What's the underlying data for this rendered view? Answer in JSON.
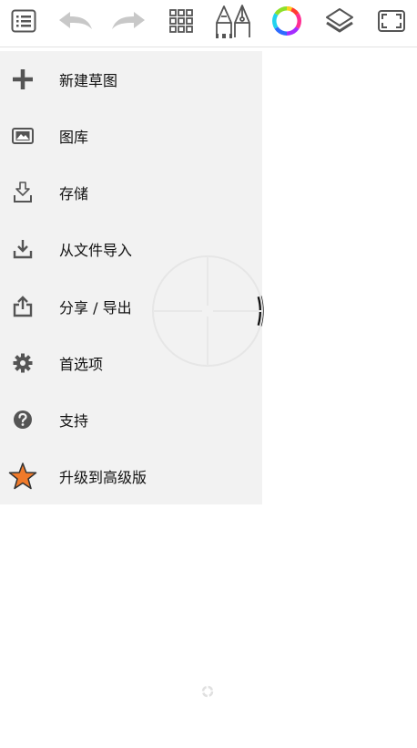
{
  "toolbar": {
    "buttons": [
      {
        "icon": "menu-list-icon",
        "enabled": true
      },
      {
        "icon": "undo-icon",
        "enabled": false
      },
      {
        "icon": "redo-icon",
        "enabled": false
      },
      {
        "icon": "grid-icon",
        "enabled": true
      },
      {
        "icon": "brush-library-icon",
        "enabled": true
      },
      {
        "icon": "color-wheel-icon",
        "enabled": true
      },
      {
        "icon": "layers-icon",
        "enabled": true
      },
      {
        "icon": "fullscreen-icon",
        "enabled": true
      }
    ]
  },
  "menu": {
    "items": [
      {
        "label": "新建草图",
        "icon": "plus-icon"
      },
      {
        "label": "图库",
        "icon": "gallery-icon"
      },
      {
        "label": "存储",
        "icon": "save-icon"
      },
      {
        "label": "从文件导入",
        "icon": "import-icon"
      },
      {
        "label": "分享 / 导出",
        "icon": "share-export-icon"
      },
      {
        "label": "首选项",
        "icon": "gear-icon"
      },
      {
        "label": "支持",
        "icon": "help-icon"
      },
      {
        "label": "升级到高级版",
        "icon": "star-icon"
      }
    ]
  },
  "colors": {
    "menu_background": "#f2f2f2",
    "icon": "#555555",
    "disabled_icon": "#c8c8c8",
    "star": "#f07a2a"
  }
}
